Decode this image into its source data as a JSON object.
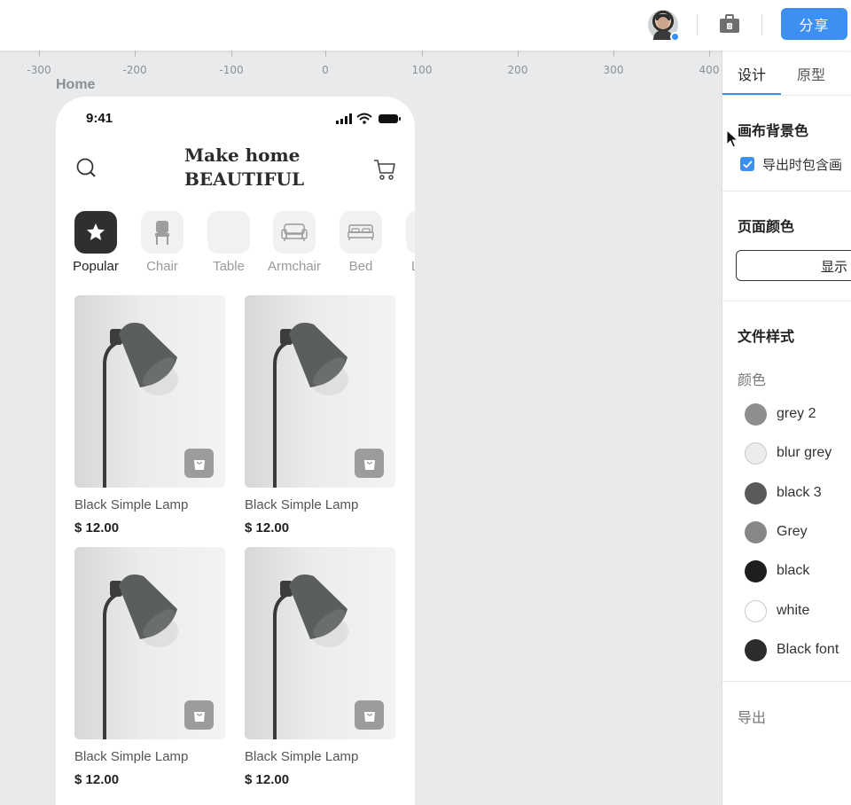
{
  "topbar": {
    "share_label": "分享",
    "avatar_icon": "user-avatar",
    "briefcase_icon": "briefcase-icon",
    "accent_color": "#3d8ff0"
  },
  "ruler": {
    "labels": [
      "-300",
      "-200",
      "-100",
      "0",
      "100",
      "200",
      "300",
      "400"
    ]
  },
  "canvas": {
    "frame_label": "Home"
  },
  "phone": {
    "status_time": "9:41",
    "headline_line1": "Make home",
    "headline_line2": "BEAUTIFUL",
    "categories": [
      {
        "label": "Popular",
        "icon": "star-icon",
        "active": true
      },
      {
        "label": "Chair",
        "icon": "chair-icon",
        "active": false
      },
      {
        "label": "Table",
        "icon": "table-icon",
        "active": false
      },
      {
        "label": "Armchair",
        "icon": "armchair-icon",
        "active": false
      },
      {
        "label": "Bed",
        "icon": "bed-icon",
        "active": false
      },
      {
        "label": "La",
        "icon": "lamp-icon",
        "active": false
      }
    ],
    "products": [
      {
        "name": "Black Simple Lamp",
        "price": "$ 12.00"
      },
      {
        "name": "Black Simple Lamp",
        "price": "$ 12.00"
      },
      {
        "name": "Black Simple Lamp",
        "price": "$ 12.00"
      },
      {
        "name": "Black Simple Lamp",
        "price": "$ 12.00"
      }
    ]
  },
  "panel": {
    "tabs": [
      {
        "label": "设计",
        "active": true
      },
      {
        "label": "原型",
        "active": false
      }
    ],
    "canvas_bg_title": "画布背景色",
    "include_canvas_label": "导出时包含画",
    "page_color_title": "页面颜色",
    "show_button_label": "显示",
    "file_style_title": "文件样式",
    "color_subhead": "颜色",
    "colors": [
      {
        "name": "grey 2",
        "hex": "#8e8e8e"
      },
      {
        "name": "blur grey",
        "hex": "#ececec"
      },
      {
        "name": "black 3",
        "hex": "#5a5a5a"
      },
      {
        "name": "Grey",
        "hex": "#878787"
      },
      {
        "name": "black",
        "hex": "#1e1e1e"
      },
      {
        "name": "white",
        "hex": "#ffffff"
      },
      {
        "name": "Black font",
        "hex": "#2c2c2c"
      }
    ],
    "export_label": "导出"
  }
}
